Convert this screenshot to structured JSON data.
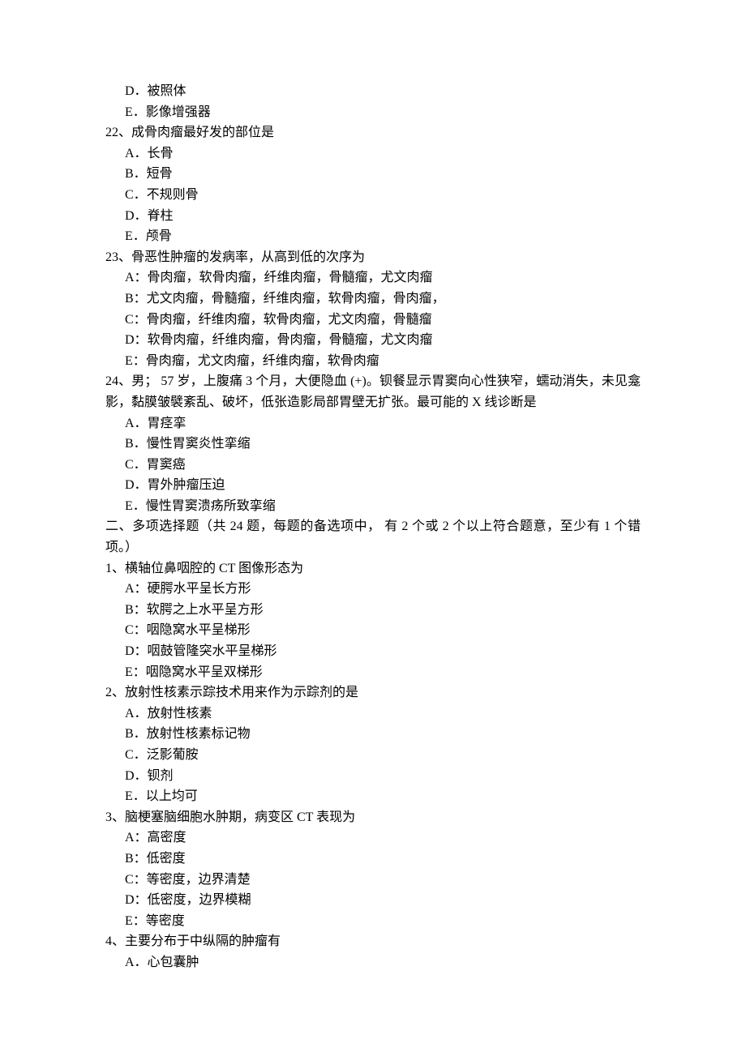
{
  "q21_trailing": {
    "optD": "D．被照体",
    "optE": "E．影像增强器"
  },
  "q22": {
    "stem": "22、成骨肉瘤最好发的部位是",
    "optA": "A．长骨",
    "optB": "B．短骨",
    "optC": "C．不规则骨",
    "optD": "D．脊柱",
    "optE": "E．颅骨"
  },
  "q23": {
    "stem": "23、骨恶性肿瘤的发病率，从高到低的次序为",
    "optA": "A：骨肉瘤，软骨肉瘤，纤维肉瘤，骨髓瘤，尤文肉瘤",
    "optB": "B：尤文肉瘤，骨髓瘤，纤维肉瘤，软骨肉瘤，骨肉瘤，",
    "optC": "C：骨肉瘤，纤维肉瘤，软骨肉瘤，尤文肉瘤，骨髓瘤",
    "optD": "D：软骨肉瘤，纤维肉瘤，骨肉瘤，骨髓瘤，尤文肉瘤",
    "optE": "E：骨肉瘤，尤文肉瘤，纤维肉瘤，软骨肉瘤"
  },
  "q24": {
    "stem": "24、男； 57 岁，上腹痛 3 个月，大便隐血 (+)。钡餐显示胃窦向心性狭窄，蠕动消失，未见龛影，黏膜皱襞紊乱、破坏，低张造影局部胃壁无扩张。最可能的 X 线诊断是",
    "optA": "A．胃痉挛",
    "optB": "B．慢性胃窦炎性挛缩",
    "optC": "C．胃窦癌",
    "optD": "D．胃外肿瘤压迫",
    "optE": "E．慢性胃窦溃疡所致挛缩"
  },
  "section2": "二、多项选择题（共 24 题，每题的备选项中，  有 2 个或 2 个以上符合题意，至少有 1 个错项。）",
  "s2q1": {
    "stem": "1、横轴位鼻咽腔的  CT 图像形态为",
    "optA": "A：硬腭水平呈长方形",
    "optB": "B：软腭之上水平呈方形",
    "optC": "C：咽隐窝水平呈梯形",
    "optD": "D：咽鼓管隆突水平呈梯形",
    "optE": "E：咽隐窝水平呈双梯形"
  },
  "s2q2": {
    "stem": "2、放射性核素示踪技术用来作为示踪剂的是",
    "optA": "A．放射性核素",
    "optB": "B．放射性核素标记物",
    "optC": "C．泛影葡胺",
    "optD": "D．钡剂",
    "optE": "E．以上均可"
  },
  "s2q3": {
    "stem": "3、脑梗塞脑细胞水肿期，病变区   CT 表现为",
    "optA": "A：高密度",
    "optB": "B：低密度",
    "optC": "C：等密度，边界清楚",
    "optD": "D：低密度，边界模糊",
    "optE": "E：等密度"
  },
  "s2q4": {
    "stem": "4、主要分布于中纵隔的肿瘤有",
    "optA": "A．心包囊肿"
  }
}
